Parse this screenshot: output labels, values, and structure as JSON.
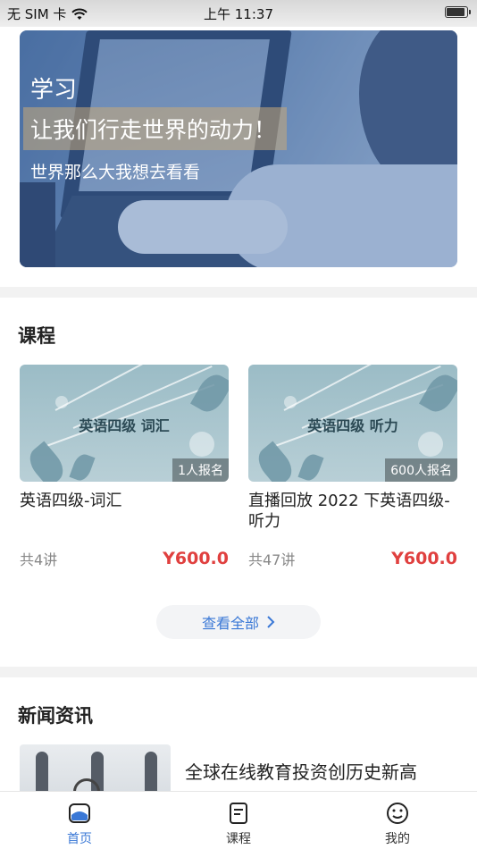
{
  "status_bar": {
    "carrier": "无 SIM 卡",
    "time": "上午 11:37"
  },
  "banner": {
    "line1": "学习",
    "line2": "让我们行走世界的动力！",
    "line3": "世界那么大我想去看看"
  },
  "courses_section": {
    "title": "课程",
    "courses": [
      {
        "thumb_title": "英语四级 词汇",
        "enrolled": "1人报名",
        "name": "英语四级-词汇",
        "lessons": "共4讲",
        "price": "Y600.0"
      },
      {
        "thumb_title": "英语四级 听力",
        "enrolled": "600人报名",
        "name": "直播回放 2022 下英语四级-听力",
        "lessons": "共47讲",
        "price": "Y600.0"
      }
    ],
    "view_all": "查看全部"
  },
  "news_section": {
    "title": "新闻资讯",
    "items": [
      {
        "title": "全球在线教育投资创历史新高"
      }
    ]
  },
  "tabbar": {
    "tabs": [
      {
        "label": "首页",
        "icon": "home-icon",
        "active": true
      },
      {
        "label": "课程",
        "icon": "course-icon",
        "active": false
      },
      {
        "label": "我的",
        "icon": "smiley-icon",
        "active": false
      }
    ]
  },
  "colors": {
    "accent": "#3a78d6",
    "price": "#e0403f"
  }
}
